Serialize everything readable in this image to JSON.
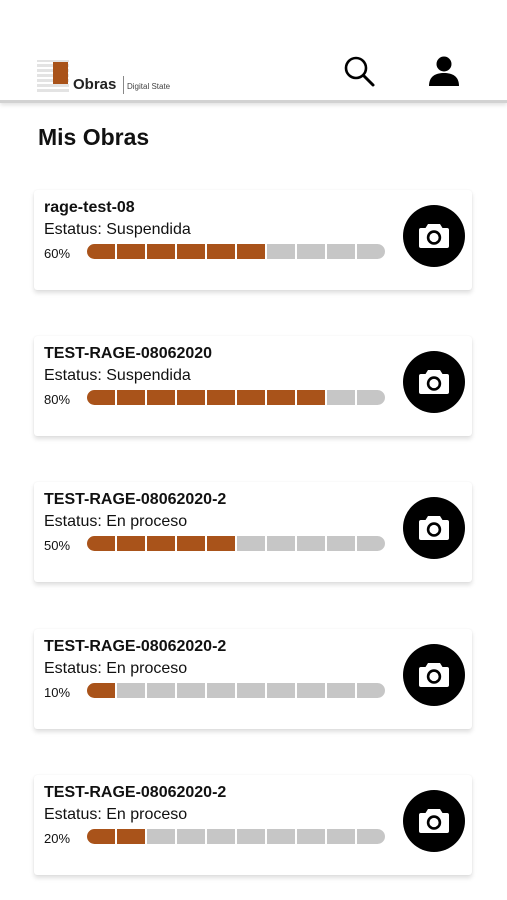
{
  "header": {
    "logo_name": "Obras",
    "logo_sub": "Digital State",
    "icons": [
      "search-icon",
      "user-icon"
    ],
    "accent_color": "#a9531a"
  },
  "page": {
    "title": "Mis Obras"
  },
  "obras": [
    {
      "name": "rage-test-08",
      "status": "Estatus: Suspendida",
      "percent_label": "60%",
      "progress": 0.6
    },
    {
      "name": "TEST-RAGE-08062020",
      "status": "Estatus: Suspendida",
      "percent_label": "80%",
      "progress": 0.8
    },
    {
      "name": "TEST-RAGE-08062020-2",
      "status": "Estatus: En proceso",
      "percent_label": "50%",
      "progress": 0.5
    },
    {
      "name": "TEST-RAGE-08062020-2",
      "status": "Estatus: En proceso",
      "percent_label": "10%",
      "progress": 0.1
    },
    {
      "name": "TEST-RAGE-08062020-2",
      "status": "Estatus: En proceso",
      "percent_label": "20%",
      "progress": 0.2
    }
  ],
  "progress_colors": {
    "filled": "#a9531a",
    "empty": "#c6c6c6"
  }
}
